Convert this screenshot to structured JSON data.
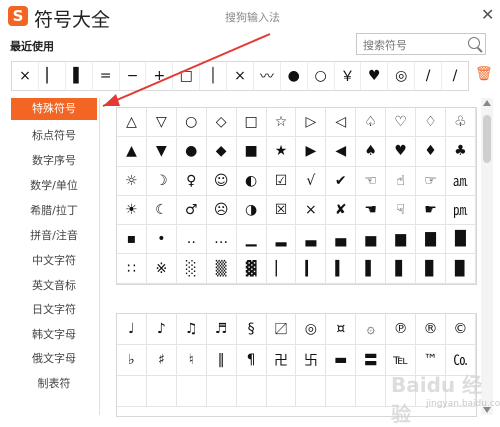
{
  "title": "符号大全",
  "window_subtitle": "搜狗输入法",
  "close_icon": "✕",
  "recent_label": "最近使用",
  "search_placeholder": "搜索符号",
  "recent_symbols": [
    "×",
    "▏",
    "▌",
    "=",
    "−",
    "+",
    "□",
    "│",
    "×",
    "〰",
    "●",
    "○",
    "￥",
    "♥",
    "◎",
    "/",
    "/"
  ],
  "sidebar_items": [
    "特殊符号",
    "标点符号",
    "数字序号",
    "数学/单位",
    "希腊/拉丁",
    "拼音/注音",
    "中文字符",
    "英文音标",
    "日文字符",
    "韩文字母",
    "俄文字母",
    "制表符"
  ],
  "active_category": "特殊符号",
  "symbols_top": [
    [
      "△",
      "▽",
      "○",
      "◇",
      "□",
      "☆",
      "▷",
      "◁",
      "♤",
      "♡",
      "♢",
      "♧"
    ],
    [
      "▲",
      "▼",
      "●",
      "◆",
      "■",
      "★",
      "▶",
      "◀",
      "♠",
      "♥",
      "♦",
      "♣"
    ],
    [
      "☼",
      "☽",
      "♀",
      "☺",
      "◐",
      "☑",
      "√",
      "✔",
      "☜",
      "☝",
      "☞",
      "㏂"
    ],
    [
      "☀",
      "☾",
      "♂",
      "☹",
      "◑",
      "☒",
      "×",
      "✘",
      "☚",
      "☟",
      "☛",
      "㏘"
    ],
    [
      "▪",
      "•",
      "‥",
      "…",
      "▁",
      "▂",
      "▃",
      "▄",
      "▅",
      "▆",
      "▇",
      "█"
    ],
    [
      "∷",
      "※",
      "░",
      "▒",
      "▓",
      "▏",
      "▎",
      "▍",
      "▌",
      "▋",
      "▊",
      "▉"
    ]
  ],
  "symbols_bottom": [
    [
      "♩",
      "♪",
      "♫",
      "♬",
      "§",
      "〼",
      "◎",
      "¤",
      "۞",
      "℗",
      "®",
      "©"
    ],
    [
      "♭",
      "♯",
      "♮",
      "‖",
      "¶",
      "卍",
      "卐",
      "▬",
      "〓",
      "℡",
      "™",
      "㏇"
    ],
    [
      "",
      "",
      "",
      "",
      "",
      "",
      "",
      "",
      "",
      "",
      "",
      ""
    ]
  ],
  "watermark": "Baidu 经验",
  "watermark_sub": "jingyan.baidu.com",
  "colors": {
    "accent": "#f26522",
    "border": "#d7d7d7",
    "arrow": "#e53935"
  }
}
